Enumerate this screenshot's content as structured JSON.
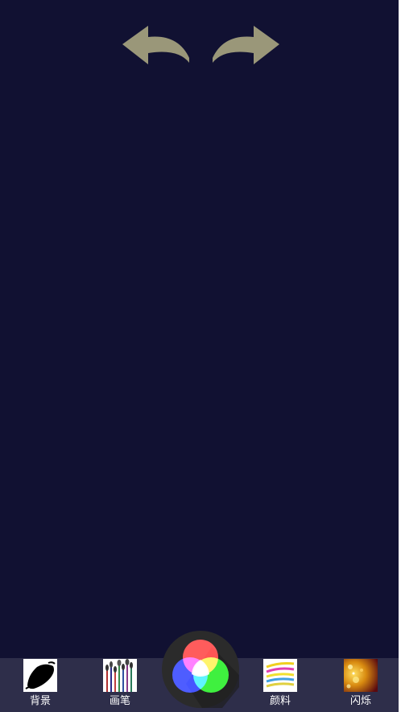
{
  "toolbar": {
    "undo_icon": "undo-arrow-icon",
    "redo_icon": "redo-arrow-icon",
    "arrow_color": "#9a9779"
  },
  "canvas": {
    "background_color": "#111132"
  },
  "bottom_bar": {
    "tools": [
      {
        "label": "背景",
        "icon": "background-brush-stroke-icon"
      },
      {
        "label": "画笔",
        "icon": "paintbrushes-icon"
      },
      {
        "label": "颜料",
        "icon": "paint-strokes-icon"
      },
      {
        "label": "闪烁",
        "icon": "sparkle-lights-icon"
      }
    ],
    "color_picker_icon": "rgb-color-wheel-icon"
  }
}
